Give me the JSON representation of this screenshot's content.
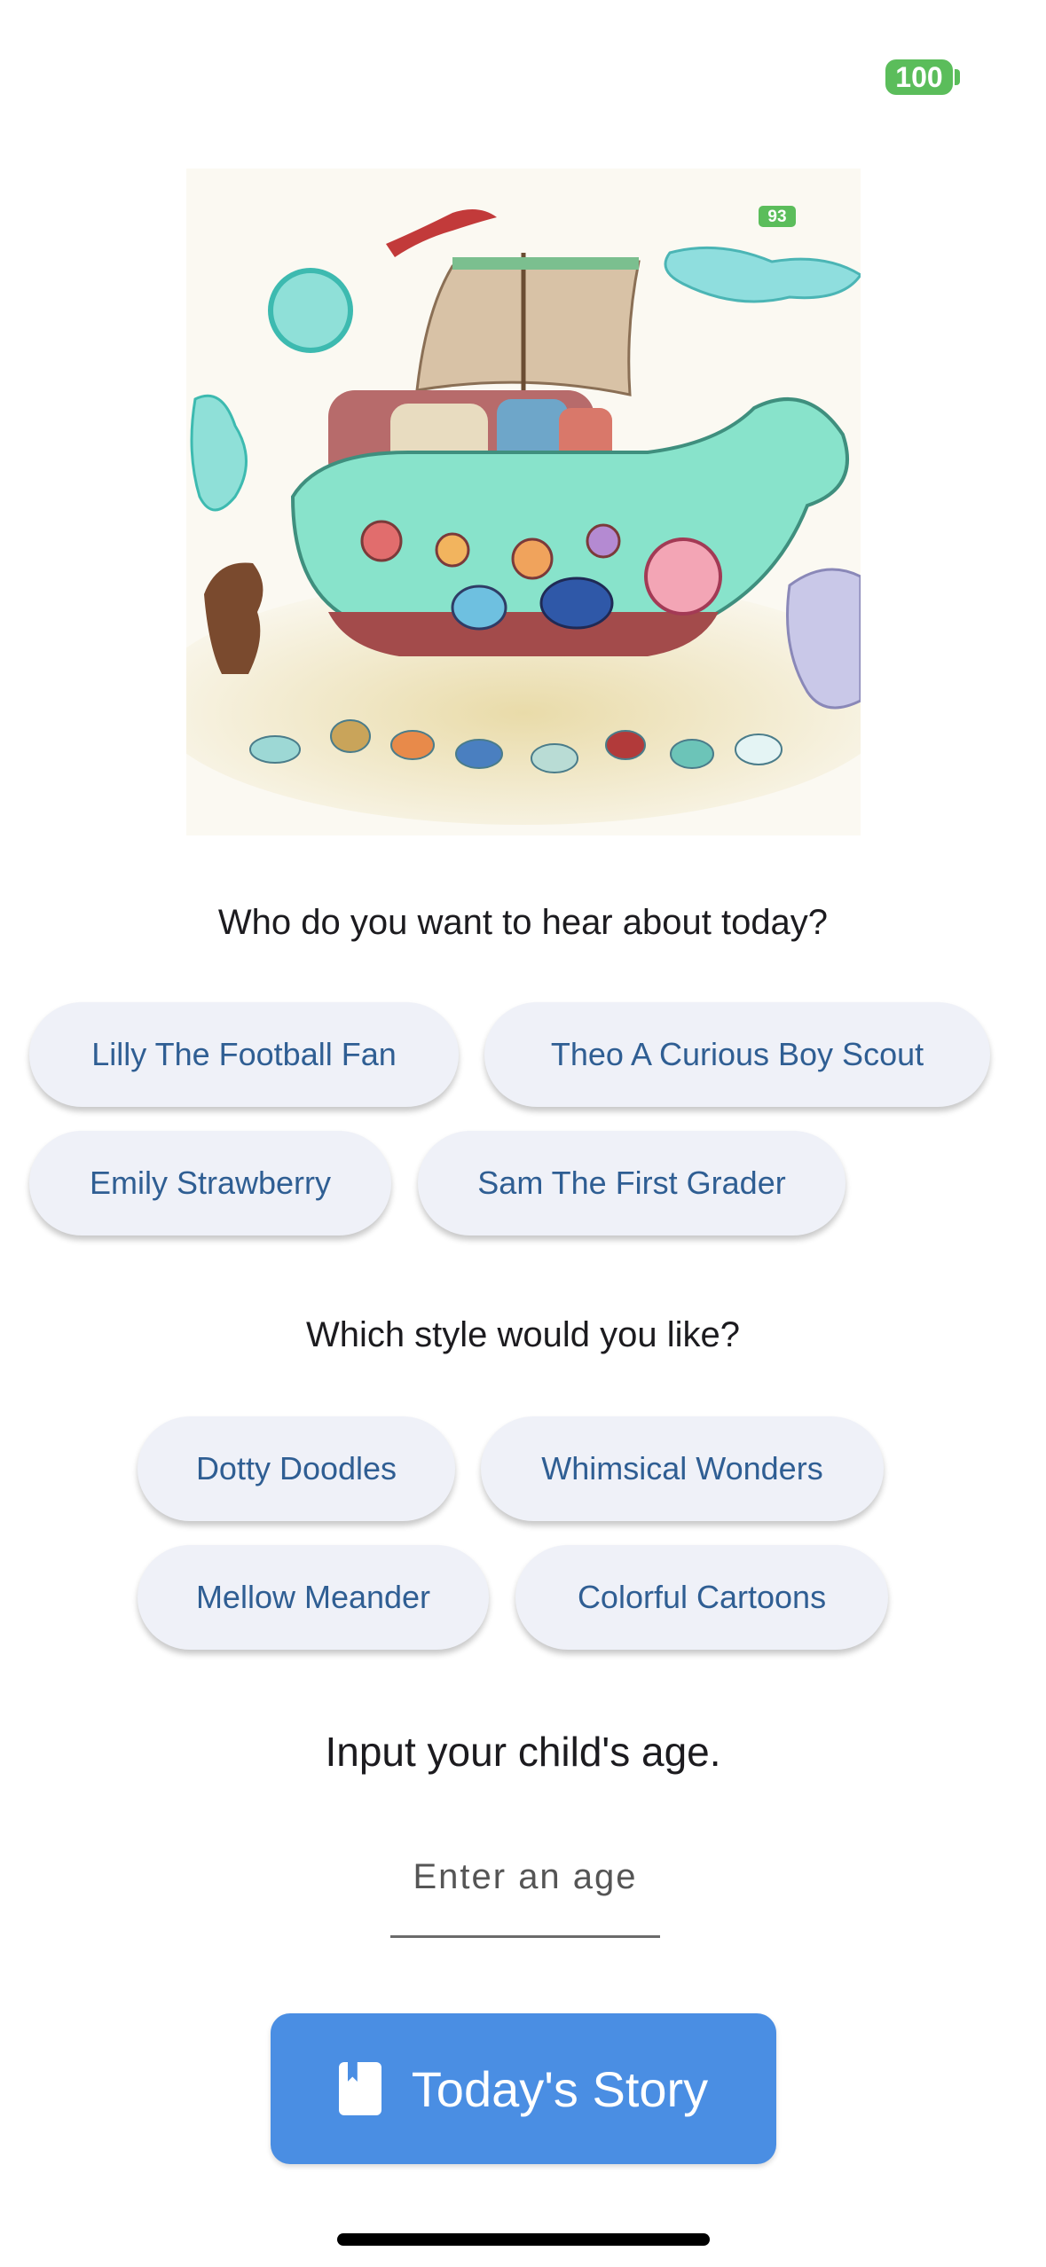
{
  "status_bar": {
    "battery": "100"
  },
  "hero": {
    "badge": "93"
  },
  "characters": {
    "prompt": "Who do you want to hear about today?",
    "options": [
      "Lilly The Football Fan",
      "Theo A Curious Boy Scout",
      "Emily Strawberry",
      "Sam The First Grader"
    ]
  },
  "styles": {
    "prompt": "Which style would you like?",
    "options": [
      "Dotty Doodles",
      "Whimsical Wonders",
      "Mellow Meander",
      "Colorful Cartoons"
    ]
  },
  "age": {
    "prompt": "Input your child's age.",
    "placeholder": "Enter an age",
    "value": ""
  },
  "action": {
    "label": "Today's Story",
    "icon": "book-icon"
  },
  "colors": {
    "accent": "#4a8ee3",
    "chip_bg": "#eff1f8",
    "chip_text": "#2f5e93",
    "battery": "#5bbd5b"
  }
}
